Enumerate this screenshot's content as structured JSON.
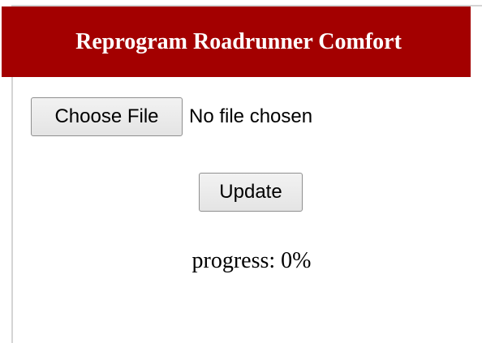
{
  "header": {
    "title": "Reprogram Roadrunner Comfort",
    "background_color": "#a30000"
  },
  "file_input": {
    "button_label": "Choose File",
    "status_text": "No file chosen"
  },
  "update_button": {
    "label": "Update"
  },
  "progress": {
    "text": "progress: 0%",
    "value_percent": 0
  }
}
